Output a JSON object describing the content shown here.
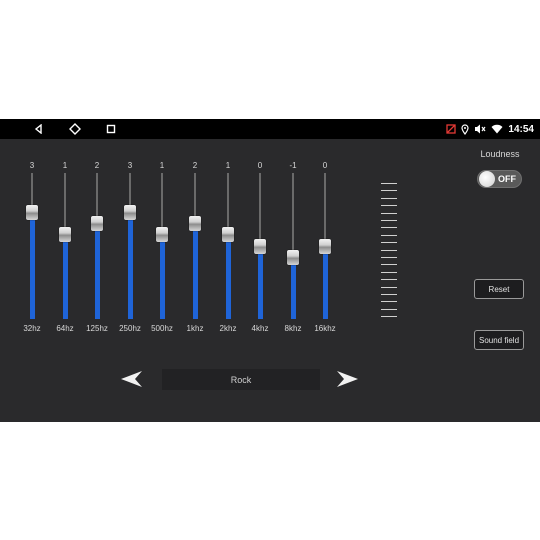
{
  "status_bar": {
    "time": "14:54",
    "nav": [
      "back-icon",
      "home-icon",
      "recents-icon"
    ],
    "indicators": [
      "notification-icon",
      "location-icon",
      "mute-icon",
      "wifi-icon"
    ]
  },
  "equalizer": {
    "range": [
      -6,
      6
    ],
    "bands": [
      {
        "label": "32hz",
        "value": 3
      },
      {
        "label": "64hz",
        "value": 1
      },
      {
        "label": "125hz",
        "value": 2
      },
      {
        "label": "250hz",
        "value": 3
      },
      {
        "label": "500hz",
        "value": 1
      },
      {
        "label": "1khz",
        "value": 2
      },
      {
        "label": "2khz",
        "value": 1
      },
      {
        "label": "4khz",
        "value": 0
      },
      {
        "label": "8khz",
        "value": -1
      },
      {
        "label": "16khz",
        "value": 0
      }
    ],
    "fill_color": "#1f64d8"
  },
  "loudness": {
    "label": "Loudness",
    "state": "OFF"
  },
  "buttons": {
    "reset": "Reset",
    "sound_field": "Sound field"
  },
  "preset": {
    "name": "Rock",
    "prev_icon": "arrow-left-icon",
    "next_icon": "arrow-right-icon"
  }
}
